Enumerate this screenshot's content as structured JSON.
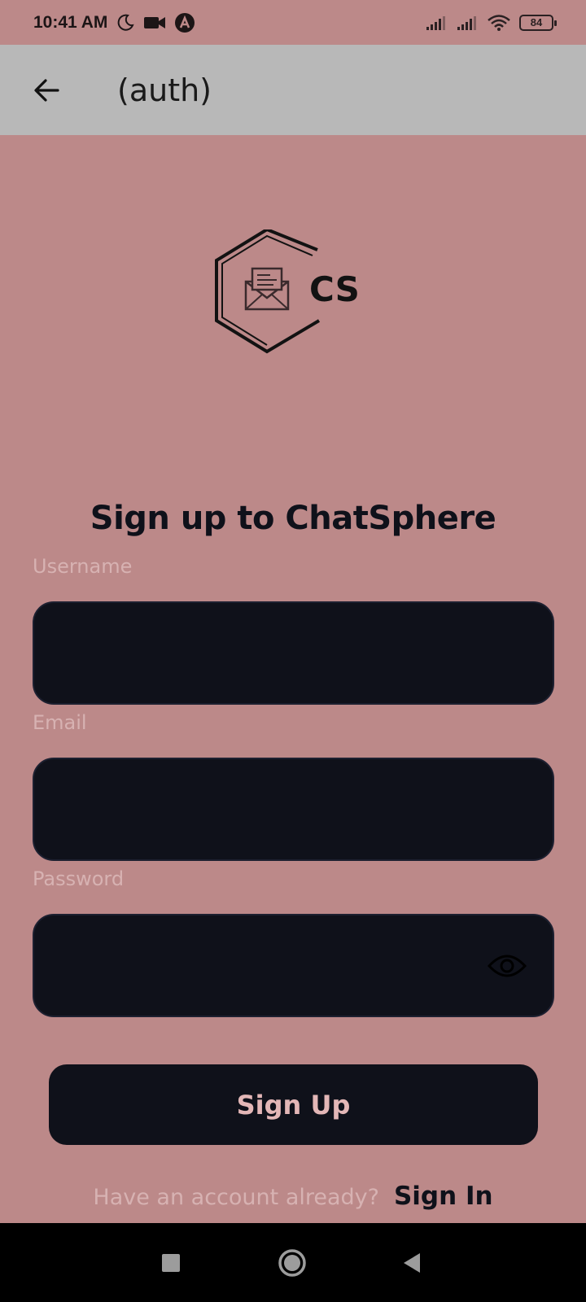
{
  "status_bar": {
    "time": "10:41 AM",
    "battery": "84",
    "icons": [
      "moon-icon",
      "video-camera-icon",
      "app-notification-icon",
      "signal-icon",
      "signal-icon",
      "wifi-icon",
      "battery-icon"
    ]
  },
  "app_bar": {
    "title": "(auth)",
    "back_icon": "arrow-left-icon"
  },
  "logo": {
    "text": "CS",
    "icon": "envelope-icon"
  },
  "form": {
    "heading": "Sign up to ChatSphere",
    "username_label": "Username",
    "username_value": "",
    "email_label": "Email",
    "email_value": "",
    "password_label": "Password",
    "password_value": "",
    "password_toggle_icon": "eye-icon",
    "submit_label": "Sign Up"
  },
  "footer": {
    "prompt": "Have an account already?",
    "link": "Sign In"
  },
  "nav_bar": {
    "buttons": [
      "recent-apps-icon",
      "home-icon",
      "back-triangle-icon"
    ]
  },
  "colors": {
    "background": "#bc8989",
    "app_bar": "#b8b8b8",
    "field": "#0f111a",
    "label": "#d7b2b2",
    "button_text": "#e3b7b7"
  }
}
